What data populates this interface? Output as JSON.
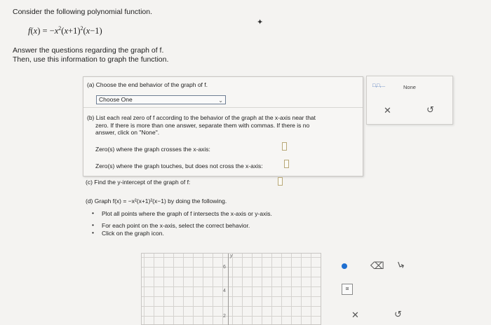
{
  "intro": {
    "line1": "Consider the following polynomial function.",
    "answer_line": "Answer the questions regarding the graph of f.",
    "then_line": "Then, use this information to graph the function."
  },
  "function_display": "f(x) = −x²(x+1)²(x−1)",
  "part_a": {
    "label": "(a) Choose the end behavior of the graph of f.",
    "dropdown_value": "Choose One"
  },
  "part_b": {
    "line1": "(b) List each real zero of f according to the behavior of the graph at the x-axis near that",
    "line2": "zero. If there is more than one answer, separate them with commas. If there is no",
    "line3": "answer, click on \"None\".",
    "crosses_label": "Zero(s) where the graph crosses the x-axis:",
    "touches_label": "Zero(s) where the graph touches, but does not cross the x-axis:"
  },
  "part_c": {
    "label": "(c) Find the y-intercept of the graph of f:"
  },
  "part_d": {
    "label": "(d) Graph f(x) = −x²(x+1)²(x−1) by doing the following.",
    "bullets": [
      "Plot all points where the graph of f intersects the x-axis or y-axis.",
      "For each point on the x-axis, select the correct behavior.",
      "Click on the graph icon."
    ]
  },
  "right_panel": {
    "none_label": "None",
    "comma_icon_label": "□,□,..."
  },
  "graph": {
    "y_axis_label": "y",
    "ticks": [
      "6",
      "4",
      "2"
    ]
  },
  "colors": {
    "accent": "#1f6fd1",
    "panel_border": "#c9c7c4",
    "box_border": "#b8a878"
  }
}
